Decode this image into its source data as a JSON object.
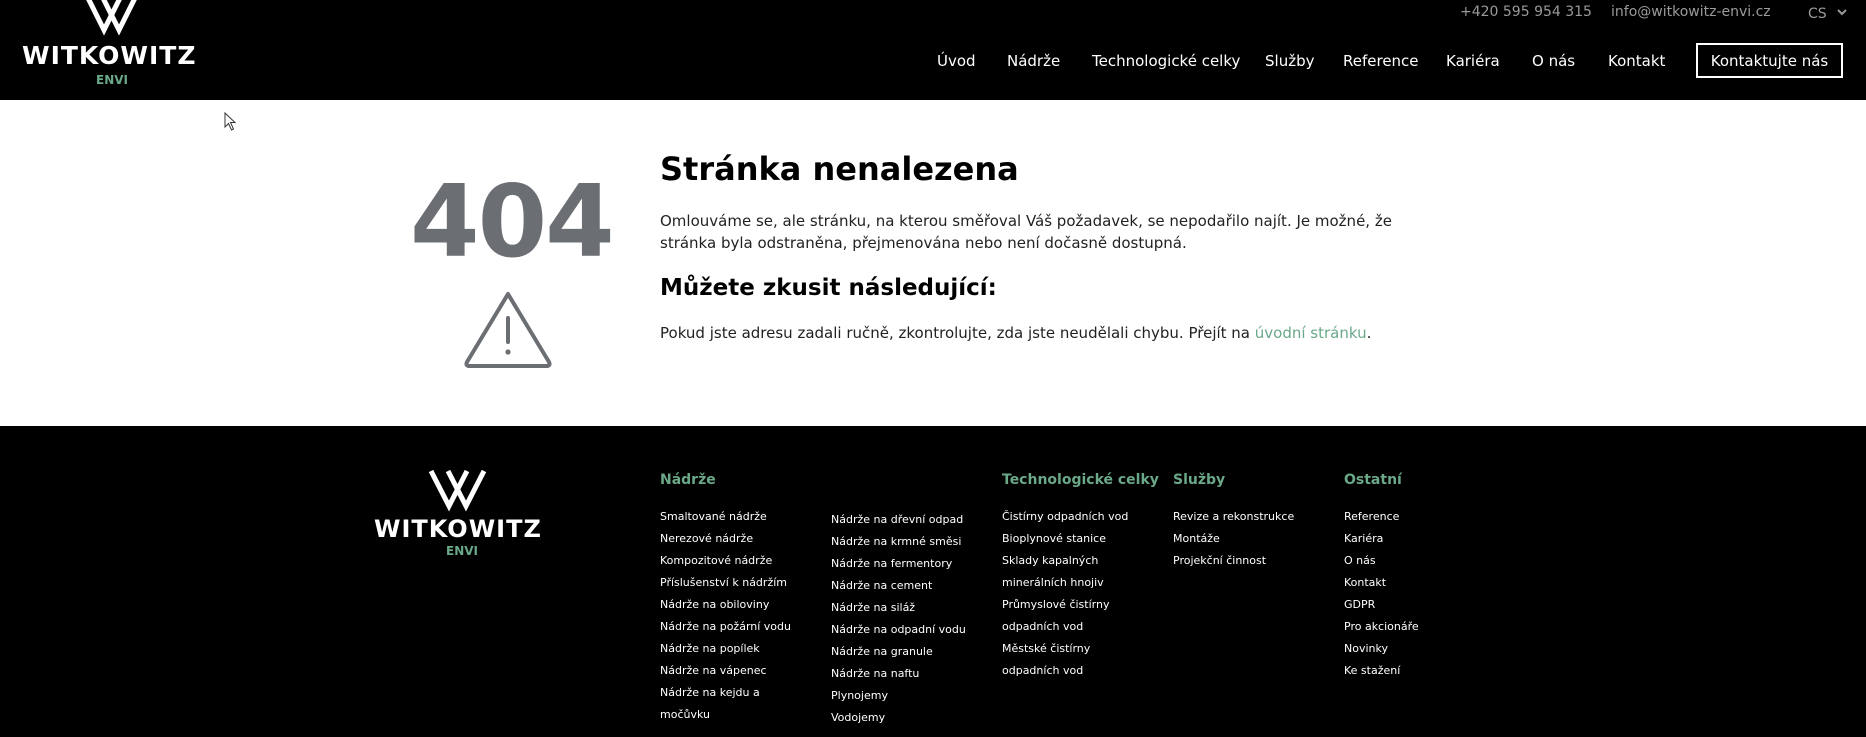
{
  "brand": {
    "name": "WITKOWITZ",
    "sub": "ENVI"
  },
  "top": {
    "phone": "+420 595 954 315",
    "email": "info@witkowitz-envi.cz",
    "lang": "CS"
  },
  "nav": [
    "Úvod",
    "Nádrže",
    "Technologické celky",
    "Služby",
    "Reference",
    "Kariéra",
    "O nás",
    "Kontakt"
  ],
  "cta": "Kontaktujte nás",
  "error": {
    "code": "404",
    "title": "Stránka nenalezena",
    "message": "Omlouváme se, ale stránku, na kterou směřoval Váš požadavek, se nepodařilo najít. Je možné, že stránka byla odstraněna, přejmenována nebo není dočasně dostupná.",
    "subtitle": "Můžete zkusit následující:",
    "hint_prefix": "Pokud jste adresu zadali ručně, zkontrolujte, zda jste neudělali chybu. Přejít na ",
    "hint_link": "úvodní stránku",
    "hint_suffix": "."
  },
  "footer": {
    "nadrze": {
      "heading": "Nádrže",
      "col1": [
        "Smaltované nádrže",
        "Nerezové nádrže",
        "Kompozitové nádrže",
        "Příslušenství k nádržím",
        "Nádrže na obiloviny",
        "Nádrže na požární vodu",
        "Nádrže na popílek",
        "Nádrže na vápenec",
        "Nádrže na kejdu a",
        "močůvku"
      ],
      "col2": [
        "Nádrže na dřevní odpad",
        "Nádrže na krmné směsi",
        "Nádrže na fermentory",
        "Nádrže na cement",
        "Nádrže na siláž",
        "Nádrže na odpadní vodu",
        "Nádrže na granule",
        "Nádrže na naftu",
        "Plynojemy",
        "Vodojemy"
      ]
    },
    "tech": {
      "heading": "Technologické celky",
      "items": [
        "Čistírny odpadních vod",
        "Bioplynové stanice",
        "Sklady kapalných",
        "minerálních hnojiv",
        "Průmyslové čistírny",
        "odpadních vod",
        "Městské čistírny",
        "odpadních vod"
      ]
    },
    "sluzby": {
      "heading": "Služby",
      "items": [
        "Revize a rekonstrukce",
        "Montáže",
        "Projekční činnost"
      ]
    },
    "ostatni": {
      "heading": "Ostatní",
      "items": [
        "Reference",
        "Kariéra",
        "O nás",
        "Kontakt",
        "GDPR",
        "Pro akcionáře",
        "Novinky",
        "Ke stažení"
      ]
    }
  },
  "colors": {
    "accent": "#6aa888",
    "dark": "#000000",
    "code": "#6b6e72"
  }
}
